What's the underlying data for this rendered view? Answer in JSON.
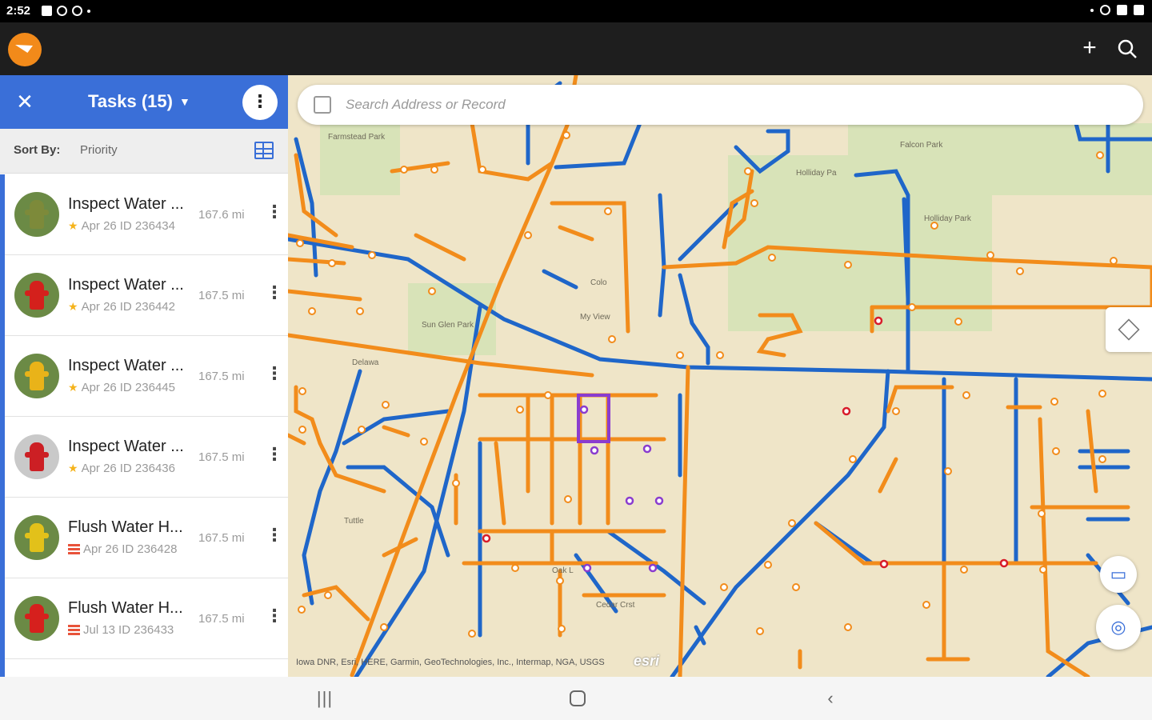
{
  "status_bar": {
    "time": "2:52"
  },
  "app_bar": {
    "add_icon": "+",
    "search_icon_name": "search-icon"
  },
  "panel": {
    "close_label": "✕",
    "title": "Tasks (15)",
    "more_label": "⋮",
    "sort_label": "Sort By:",
    "sort_value": "Priority",
    "accent": "#3a6fd8"
  },
  "tasks": [
    {
      "title": "Inspect Water ...",
      "date": "Apr 26",
      "id": "ID 236434",
      "distance": "167.6 mi",
      "priority_icon": "star-icon",
      "hydrant_color": "#7d8a3a"
    },
    {
      "title": "Inspect Water ...",
      "date": "Apr 26",
      "id": "ID 236442",
      "distance": "167.5 mi",
      "priority_icon": "star-icon",
      "hydrant_color": "#d4201c"
    },
    {
      "title": "Inspect Water ...",
      "date": "Apr 26",
      "id": "ID 236445",
      "distance": "167.5 mi",
      "priority_icon": "star-icon",
      "hydrant_color": "#e9b319"
    },
    {
      "title": "Inspect Water ...",
      "date": "Apr 26",
      "id": "ID 236436",
      "distance": "167.5 mi",
      "priority_icon": "star-icon",
      "hydrant_color": "#cc1f24"
    },
    {
      "title": "Flush Water H...",
      "date": "Apr 26",
      "id": "ID 236428",
      "distance": "167.5 mi",
      "priority_icon": "priority-high-icon",
      "hydrant_color": "#e2c11a"
    },
    {
      "title": "Flush Water H...",
      "date": "Jul 13",
      "id": "ID 236433",
      "distance": "167.5 mi",
      "priority_icon": "priority-high-icon",
      "hydrant_color": "#d6201d"
    }
  ],
  "map": {
    "search_placeholder": "Search Address or Record",
    "attribution": "Iowa DNR, Esri, HERE, Garmin, GeoTechnologies, Inc., Intermap, NGA, USGS",
    "esri_logo": "esri",
    "labels": {
      "farmstead_park": "Farmstead Park",
      "holliday": "Holliday Pa",
      "holiday_park": "Holliday Park",
      "falcon_park": "Falcon Park",
      "sun_glen_park": "Sun Glen Park",
      "delaware": "Delawa",
      "oak": "Oak L",
      "cedar_crst": "Cedar Crst",
      "tuttle": "Tuttle",
      "colo": "Colo",
      "my_view": "My View"
    },
    "colors": {
      "main_line": "#1f66c9",
      "lateral": "#f28c1b",
      "background": "#efe5c8",
      "park": "#d8e3b8"
    }
  },
  "nav_bar": {
    "recent_icon": "|||",
    "back_icon": "‹"
  }
}
